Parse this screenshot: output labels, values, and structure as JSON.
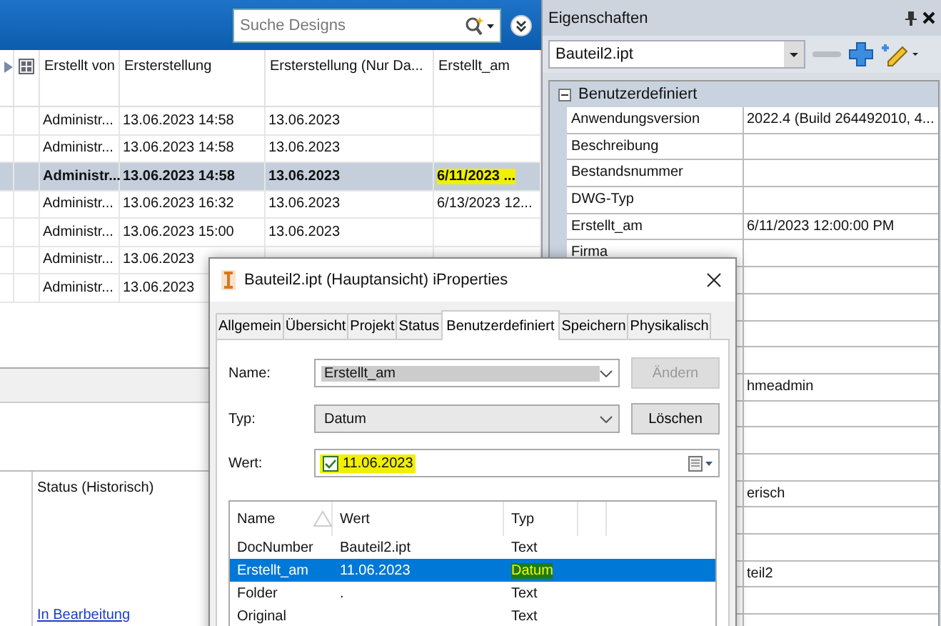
{
  "search": {
    "placeholder": "Suche Designs"
  },
  "table": {
    "columns": [
      "Erstellt von",
      "Ersterstellung",
      "Ersterstellung (Nur Da...",
      "Erstellt_am"
    ],
    "rows": [
      {
        "selected": false,
        "created_by": "Administr...",
        "first_created": "13.06.2023 14:58",
        "first_created_date": "13.06.2023"
      },
      {
        "selected": false,
        "created_by": "Administr...",
        "first_created": "13.06.2023 14:58",
        "first_created_date": "13.06.2023"
      },
      {
        "selected": true,
        "created_by": "Administr...",
        "first_created": "13.06.2023 14:58",
        "first_created_date": "13.06.2023",
        "created_on": "6/11/2023 ...",
        "created_on_highlighted": true
      },
      {
        "selected": false,
        "created_by": "Administr...",
        "first_created": "13.06.2023 16:32",
        "first_created_date": "13.06.2023",
        "created_on": "6/13/2023 12...",
        "created_on_highlighted": false
      },
      {
        "selected": false,
        "created_by": "Administr...",
        "first_created": "13.06.2023 15:00",
        "first_created_date": "13.06.2023"
      },
      {
        "selected": false,
        "created_by": "Administr...",
        "first_created": "13.06.2023"
      },
      {
        "selected": false,
        "created_by": "Administr...",
        "first_created": "13.06.2023"
      }
    ]
  },
  "history": {
    "column": "Status (Historisch)",
    "link": "In Bearbeitung"
  },
  "properties_panel": {
    "title": "Eigenschaften",
    "file": "Bauteil2.ipt",
    "group": {
      "label": "Benutzerdefiniert",
      "expanded": true
    },
    "rows": [
      {
        "name": "Anwendungsversion",
        "value": "2022.4 (Build 264492010, 4..."
      },
      {
        "name": "Beschreibung"
      },
      {
        "name": "Bestandsnummer"
      },
      {
        "name": "DWG-Typ"
      },
      {
        "name": "Erstellt_am",
        "value": "6/11/2023 12:00:00 PM"
      },
      {
        "name": "Firma"
      },
      {},
      {},
      {},
      {},
      {
        "value": "hmeadmin"
      },
      {},
      {},
      {},
      {
        "value": "erisch"
      },
      {},
      {},
      {
        "value": "teil2"
      },
      {},
      {}
    ]
  },
  "dialog": {
    "title": "Bauteil2.ipt (Hauptansicht) iProperties",
    "tabs": [
      {
        "label": "Allgemein",
        "selected": false
      },
      {
        "label": "Übersicht",
        "selected": false
      },
      {
        "label": "Projekt",
        "selected": false
      },
      {
        "label": "Status",
        "selected": false
      },
      {
        "label": "Benutzerdefiniert",
        "selected": true
      },
      {
        "label": "Speichern",
        "selected": false
      },
      {
        "label": "Physikalisch",
        "selected": false
      }
    ],
    "name": {
      "label": "Name:",
      "value": "Erstellt_am",
      "disabled": true
    },
    "type": {
      "label": "Typ:",
      "value": "Datum"
    },
    "value": {
      "label": "Wert:",
      "checked": true,
      "text": "11.06.2023",
      "highlighted": true
    },
    "buttons": [
      {
        "label": "Ändern",
        "disabled": true
      },
      {
        "label": "Löschen",
        "disabled": false
      }
    ],
    "list": {
      "columns": [
        "Name",
        "Wert",
        "Typ"
      ],
      "rows": [
        {
          "name": "DocNumber",
          "value": "Bauteil2.ipt",
          "type": "Text",
          "selected": false,
          "type_highlighted": false
        },
        {
          "name": "Erstellt_am",
          "value": "11.06.2023",
          "type": "Datum",
          "selected": true,
          "type_highlighted": true
        },
        {
          "name": "Folder",
          "value": ".",
          "type": "Text",
          "selected": false,
          "type_highlighted": false
        },
        {
          "name": "Original",
          "type": "Text",
          "selected": false,
          "type_highlighted": false
        }
      ]
    }
  }
}
